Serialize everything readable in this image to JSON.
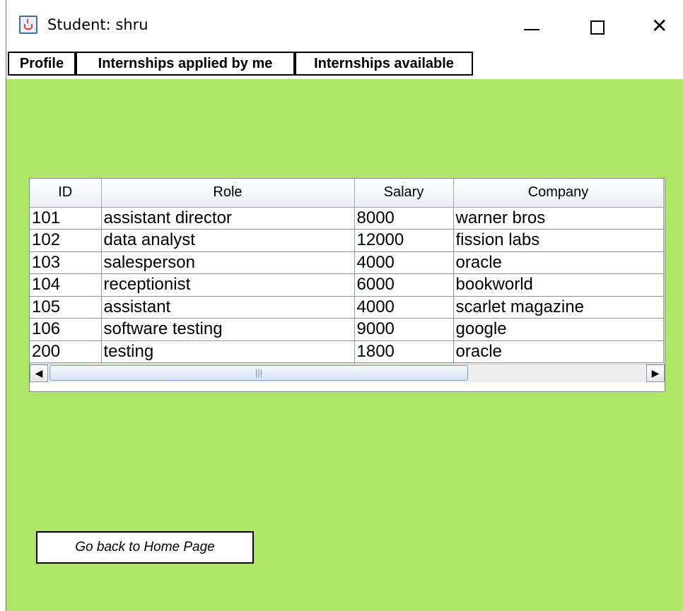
{
  "window": {
    "title": "Student: shru",
    "close_glyph": "✕"
  },
  "tabs": [
    {
      "label": "Profile"
    },
    {
      "label": "Internships applied by me"
    },
    {
      "label": "Internships available"
    }
  ],
  "table": {
    "columns": [
      "ID",
      "Role",
      "Salary",
      "Company"
    ],
    "rows": [
      [
        "101",
        "assistant director",
        "8000",
        "warner bros"
      ],
      [
        "102",
        "data analyst",
        "12000",
        "fission labs"
      ],
      [
        "103",
        "salesperson",
        "4000",
        "oracle"
      ],
      [
        "104",
        "receptionist",
        "6000",
        "bookworld"
      ],
      [
        "105",
        "assistant",
        "4000",
        "scarlet magazine"
      ],
      [
        "106",
        "software testing",
        "9000",
        "google"
      ],
      [
        "200",
        "testing",
        "1800",
        "oracle"
      ]
    ]
  },
  "scrollbar": {
    "left_arrow": "◀",
    "right_arrow": "▶",
    "thumb_grip": "|||"
  },
  "home_button": {
    "label": "Go back to Home Page"
  },
  "colors": {
    "background": "#b0e667"
  }
}
